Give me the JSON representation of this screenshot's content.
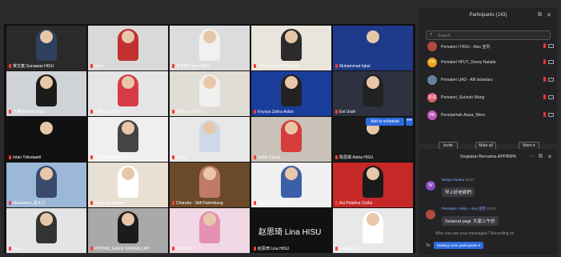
{
  "gallery": {
    "tiles": [
      {
        "name": "贺文斌 Gunawan HISU",
        "bg": "#2a2a2a",
        "shirt": "#2f3f5f"
      },
      {
        "name": "bami",
        "bg": "#d9d9d9",
        "shirt": "#c23030"
      },
      {
        "name": "张子锐 Fajar HISU",
        "bg": "#dcdcdc",
        "shirt": "#f1f1f1"
      },
      {
        "name": "I Made Dhira Wiraguna",
        "bg": "#e9e4dc",
        "shirt": "#2b2b2b"
      },
      {
        "name": "Muhammad Iqbal",
        "bg": "#1d3b8a",
        "shirt": "#1d3b8a"
      },
      {
        "name": "王蕙彤 Ibeta HISU",
        "bg": "#cfd3d8",
        "shirt": "#1b1b1b"
      },
      {
        "name": "刘莉 Lala HISU",
        "bg": "#e5e5e5",
        "shirt": "#d93a4a"
      },
      {
        "name": "杨景 ayu HISU",
        "bg": "#e0ddd6",
        "shirt": "#f0f0f0"
      },
      {
        "name": "Keysya Zahra Asfari",
        "bg": "#1a3d9c",
        "shirt": "#222"
      },
      {
        "name": "Eni Usoh",
        "bg": "#2e3240",
        "shirt": "#222"
      },
      {
        "name": "Intan Trilestaehl",
        "bg": "#111111",
        "shirt": "#111"
      },
      {
        "name": "翁程璧 MeganHISU",
        "bg": "#efefef",
        "shirt": "#444"
      },
      {
        "name": "yuling",
        "bg": "#e8e8e8",
        "shirt": "#cfd8e8"
      },
      {
        "name": "Indah Cahya",
        "bg": "#c9c2b8",
        "shirt": "#d63c3c"
      },
      {
        "name": "陈思琪 Aisha HISU",
        "bg": "#1b1b1b",
        "shirt": "#1b1b1b"
      },
      {
        "name": "Mulawarni_黑木兰",
        "bg": "#9bb8d8",
        "shirt": "#3a4a6a"
      },
      {
        "name": "Theresia Yuwono",
        "bg": "#e8e0d4",
        "shirt": "#ffffff"
      },
      {
        "name": "Chandra - Stifi Palembang",
        "bg": "#6a4a2a",
        "shirt": "#c07a6a"
      },
      {
        "name": "Pusat Kerja Sama",
        "bg": "#f0f0f0",
        "shirt": "#3c5fa8"
      },
      {
        "name": "Asi Pelafina Cicilia",
        "bg": "#c62828",
        "shirt": "#1b1b1b"
      },
      {
        "name": "Irene",
        "bg": "#e4e4e4",
        "shirt": "#333"
      },
      {
        "name": "PPPBMI_GANIK KARIMILLAH",
        "bg": "#a9a9a9",
        "shirt": "#1b1b1b"
      },
      {
        "name": "SHINTA",
        "bg": "#f0d9e4",
        "shirt": "#e690b4"
      },
      {
        "name": "赵思琦 Lina HISU",
        "bg": "#111111",
        "shirt": "#111"
      },
      {
        "name": "Pertiwi_Arief",
        "bg": "#e8e8e8",
        "shirt": "#ffffff"
      }
    ],
    "big_name": "赵思琦 Lina HISU",
    "add_schedule_label": "Add to schedule",
    "more_dots": "•••"
  },
  "participants": {
    "title": "Participants (143)",
    "search_placeholder": "Search",
    "items": [
      {
        "initials": "",
        "name": "Pemateri I HISU - Alex 亚列",
        "color": "#b04a3a"
      },
      {
        "initials": "PH",
        "name": "Pemateri HFUT_Dessy Natalia",
        "color": "#e8a317"
      },
      {
        "initials": "",
        "name": "Pemateri UAD - Alfi Istianiaru",
        "color": "#6a7f99"
      },
      {
        "initials": "苏润",
        "name": "Pemateri_Surinah Wang",
        "color": "#e05a6a"
      },
      {
        "initials": "PA",
        "name": "Penerjemah Aiasa_Wero",
        "color": "#c05ac0"
      }
    ],
    "buttons": {
      "invite": "Invite",
      "mute_all": "Mute all",
      "more": "More ▾"
    }
  },
  "chat": {
    "title": "Kegiatan Bersama APPBIPA",
    "messages": [
      {
        "avatar": "W",
        "avatar_color": "#8a4ac0",
        "sender": "Widya Pautha",
        "time": "10:07",
        "text": "早上好老師們"
      },
      {
        "avatar": "",
        "avatar_color": "#b04a3a",
        "sender": "Pemateri I HISU - Alex 亚列",
        "time": "10:07",
        "text": "Selamat pagi. 大家上午好"
      }
    ],
    "input_placeholder": "Who can see your messages? Recording on",
    "to_label": "To:",
    "to_value": "Waiting room participants ▾"
  },
  "colors": {
    "mic_muted": "#ff3b30",
    "accent": "#2d6cdf"
  }
}
